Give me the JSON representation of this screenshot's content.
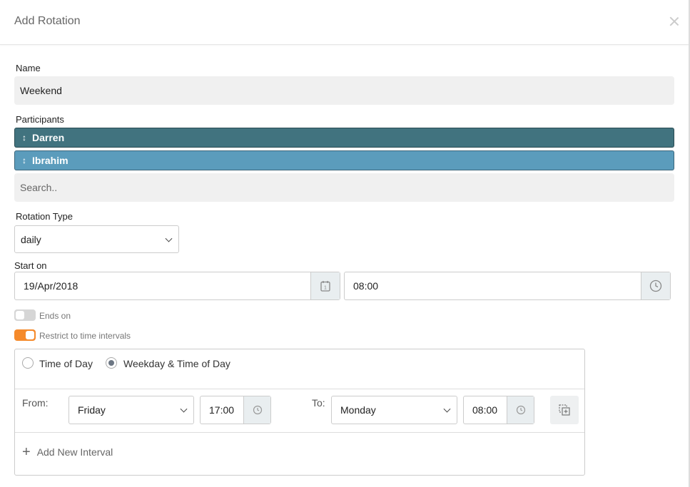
{
  "modal": {
    "title": "Add Rotation"
  },
  "name": {
    "label": "Name",
    "value": "Weekend"
  },
  "participants": {
    "label": "Participants",
    "items": [
      {
        "handle": "↕",
        "name": "Darren",
        "color": "#41737f"
      },
      {
        "handle": "↕",
        "name": "Ibrahim",
        "color": "#5b9cbc"
      }
    ],
    "search_placeholder": "Search.."
  },
  "rotation_type": {
    "label": "Rotation Type",
    "value": "daily"
  },
  "start_on": {
    "label": "Start on",
    "date": "19/Apr/2018",
    "time": "08:00",
    "calendar_day": "1"
  },
  "ends_on": {
    "label": "Ends on",
    "enabled": false
  },
  "restrict": {
    "label": "Restrict to time intervals",
    "enabled": true,
    "accent": "#f58a2b"
  },
  "interval_mode": {
    "options": [
      "Time of Day",
      "Weekday & Time of Day"
    ],
    "selected": "Weekday & Time of Day"
  },
  "interval": {
    "from_label": "From:",
    "from_day": "Friday",
    "from_time": "17:00",
    "to_label": "To:",
    "to_day": "Monday",
    "to_time": "08:00"
  },
  "add_interval": {
    "label": "Add New Interval",
    "icon": "plus-icon"
  }
}
